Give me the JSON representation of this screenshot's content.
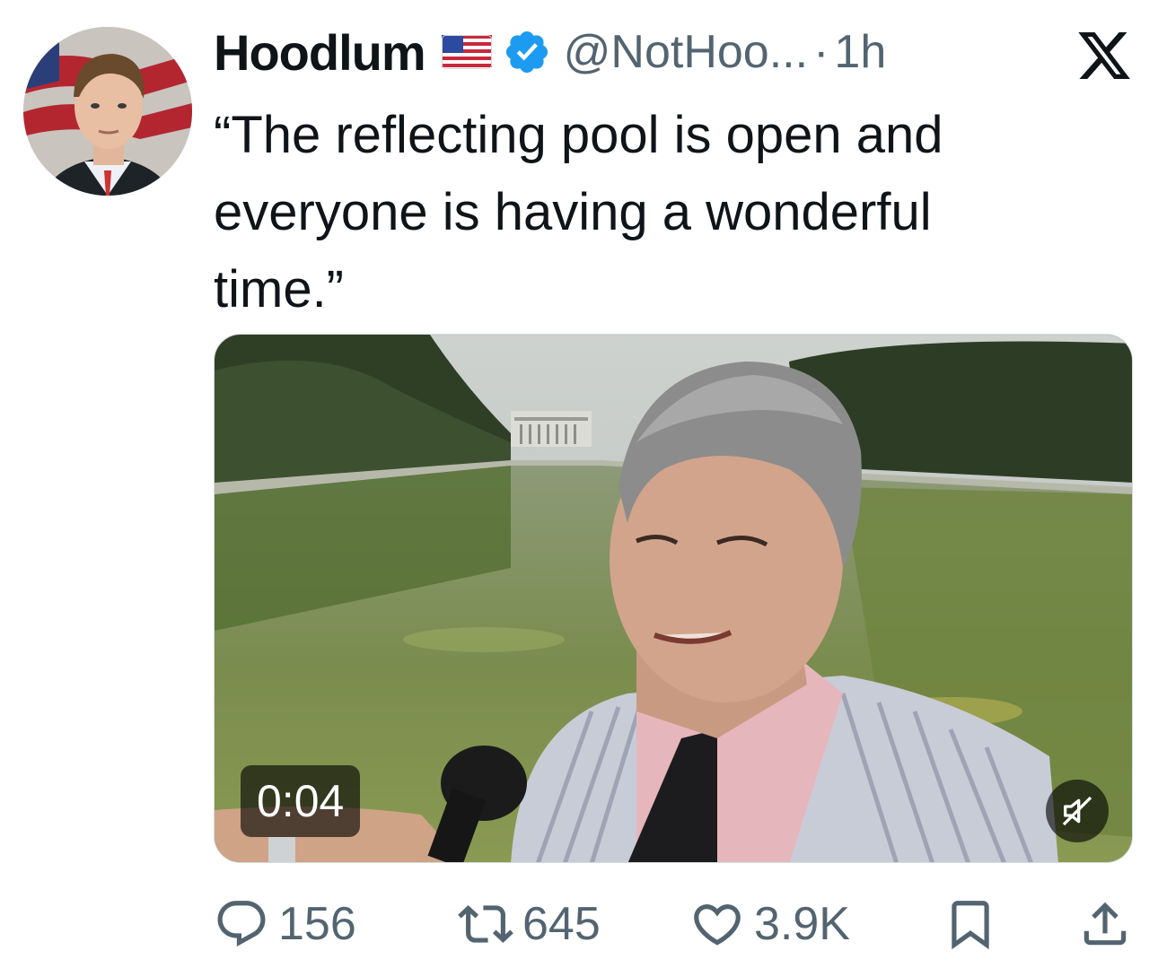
{
  "author": {
    "display_name": "Hoodlum",
    "flag_emoji": "us-flag",
    "verified_badge": "verified-check-icon",
    "handle": "@NotHoo...",
    "separator": "·",
    "time": "1h"
  },
  "tweet": {
    "text": "“The reflecting pool is open and everyone is having a wonderful time.”"
  },
  "media": {
    "type": "video",
    "duration_label": "0:04",
    "muted": true,
    "mute_icon": "speaker-muted-icon"
  },
  "actions": {
    "replies": "156",
    "reposts": "645",
    "likes": "3.9K",
    "bookmark_icon": "bookmark-icon",
    "share_icon": "share-icon"
  },
  "colors": {
    "verified_blue": "#1d9bf0",
    "secondary_text": "#536471",
    "primary_text": "#0f1419"
  }
}
